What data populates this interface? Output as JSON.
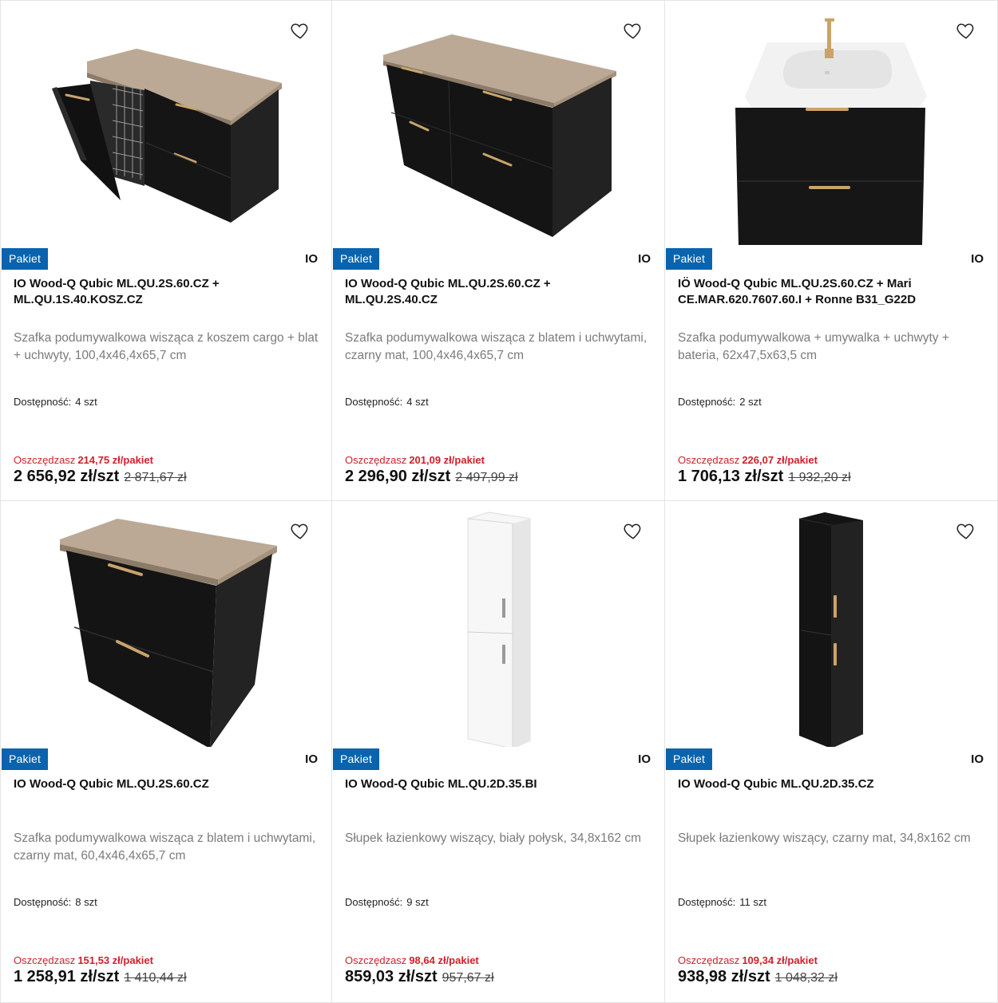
{
  "products": [
    {
      "badge": "Pakiet",
      "brand": "IO",
      "title": "IO Wood-Q Qubic ML.QU.2S.60.CZ + ML.QU.1S.40.KOSZ.CZ",
      "description": "Szafka podumywalkowa wisząca z koszem cargo + blat + uchwyty, 100,4x46,4x65,7 cm",
      "availability_label": "Dostępność:",
      "availability": "4 szt",
      "savings_label": "Oszczędzasz",
      "savings": "214,75 zł/pakiet",
      "price": "2 656,92 zł/szt",
      "old_price": "2 871,67 zł",
      "image": "black-cabinet-with-cargo-basket",
      "favorite_icon": "heart-outline-icon"
    },
    {
      "badge": "Pakiet",
      "brand": "IO",
      "title": "IO Wood-Q Qubic ML.QU.2S.60.CZ + ML.QU.2S.40.CZ",
      "description": "Szafka podumywalkowa wisząca z blatem i uchwytami, czarny mat, 100,4x46,4x65,7 cm",
      "availability_label": "Dostępność:",
      "availability": "4 szt",
      "savings_label": "Oszczędzasz",
      "savings": "201,09 zł/pakiet",
      "price": "2 296,90 zł/szt",
      "old_price": "2 497,99 zł",
      "image": "black-wide-cabinet-four-drawers",
      "favorite_icon": "heart-outline-icon"
    },
    {
      "badge": "Pakiet",
      "brand": "IO",
      "title": "IÖ Wood-Q Qubic ML.QU.2S.60.CZ + Mari CE.MAR.620.7607.60.I + Ronne B31_G22D",
      "description": "Szafka podumywalkowa + umywalka + uchwyty + bateria, 62x47,5x63,5 cm",
      "availability_label": "Dostępność:",
      "availability": "2 szt",
      "savings_label": "Oszczędzasz",
      "savings": "226,07 zł/pakiet",
      "price": "1 706,13 zł/szt",
      "old_price": "1 932,20 zł",
      "image": "black-cabinet-with-sink-and-faucet",
      "favorite_icon": "heart-outline-icon"
    },
    {
      "badge": "Pakiet",
      "brand": "IO",
      "title": "IO Wood-Q Qubic ML.QU.2S.60.CZ",
      "description": "Szafka podumywalkowa wisząca z blatem i uchwytami, czarny mat, 60,4x46,4x65,7 cm",
      "availability_label": "Dostępność:",
      "availability": "8 szt",
      "savings_label": "Oszczędzasz",
      "savings": "151,53 zł/pakiet",
      "price": "1 258,91 zł/szt",
      "old_price": "1 410,44 zł",
      "image": "black-cabinet-two-drawers-wood-top",
      "favorite_icon": "heart-outline-icon"
    },
    {
      "badge": "Pakiet",
      "brand": "IO",
      "title": "IO Wood-Q Qubic ML.QU.2D.35.BI",
      "description": "Słupek łazienkowy wiszący, biały połysk, 34,8x162 cm",
      "availability_label": "Dostępność:",
      "availability": "9 szt",
      "savings_label": "Oszczędzasz",
      "savings": "98,64 zł/pakiet",
      "price": "859,03 zł/szt",
      "old_price": "957,67 zł",
      "image": "white-tall-column",
      "favorite_icon": "heart-outline-icon"
    },
    {
      "badge": "Pakiet",
      "brand": "IO",
      "title": "IO Wood-Q Qubic ML.QU.2D.35.CZ",
      "description": "Słupek łazienkowy wiszący, czarny mat, 34,8x162 cm",
      "availability_label": "Dostępność:",
      "availability": "11 szt",
      "savings_label": "Oszczędzasz",
      "savings": "109,34 zł/pakiet",
      "price": "938,98 zł/szt",
      "old_price": "1 048,32 zł",
      "image": "black-tall-column",
      "favorite_icon": "heart-outline-icon"
    }
  ],
  "colors": {
    "badge_bg": "#0a63ad",
    "savings": "#d0202a",
    "cabinet_black": "#1c1c1c",
    "wood_top": "#b9a995",
    "gold_handle": "#c9a46a"
  }
}
